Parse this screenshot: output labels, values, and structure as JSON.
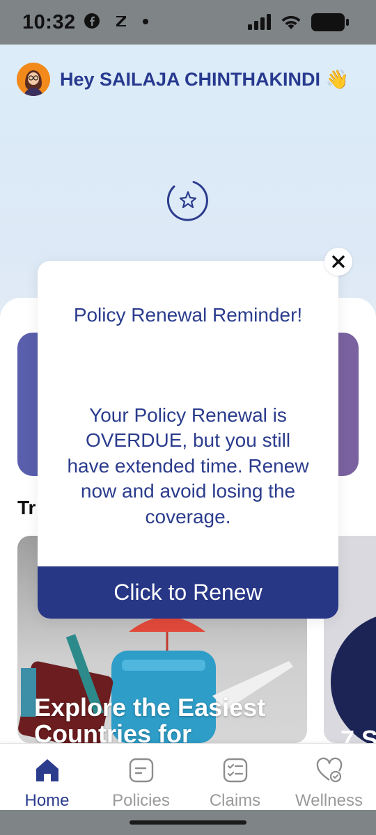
{
  "status_bar": {
    "time": "10:32",
    "left_icons": [
      "facebook-icon",
      "z-icon",
      "dot-icon"
    ],
    "right_icons": [
      "signal-icon",
      "wifi-icon",
      "battery-icon"
    ]
  },
  "header": {
    "greeting": "Hey SAILAJA CHINTHAKINDI 👋"
  },
  "section_peek": "Tr",
  "promo_cards": [
    {
      "title": "Explore the Easiest Countries for"
    },
    {
      "title": "7 S"
    }
  ],
  "modal": {
    "title": "Policy Renewal Reminder!",
    "body": "Your Policy Renewal is OVERDUE, but you still have extended time. Renew now and avoid losing the coverage.",
    "button_label": "Click to Renew",
    "close_icon": "close-icon"
  },
  "bottom_nav": {
    "items": [
      {
        "label": "Home",
        "icon": "home-icon",
        "active": true
      },
      {
        "label": "Policies",
        "icon": "document-icon",
        "active": false
      },
      {
        "label": "Claims",
        "icon": "checklist-icon",
        "active": false
      },
      {
        "label": "Wellness",
        "icon": "heart-check-icon",
        "active": false
      }
    ]
  },
  "colors": {
    "primary": "#283686",
    "text_primary": "#2b3c8d",
    "inactive": "#9a9a9a"
  }
}
